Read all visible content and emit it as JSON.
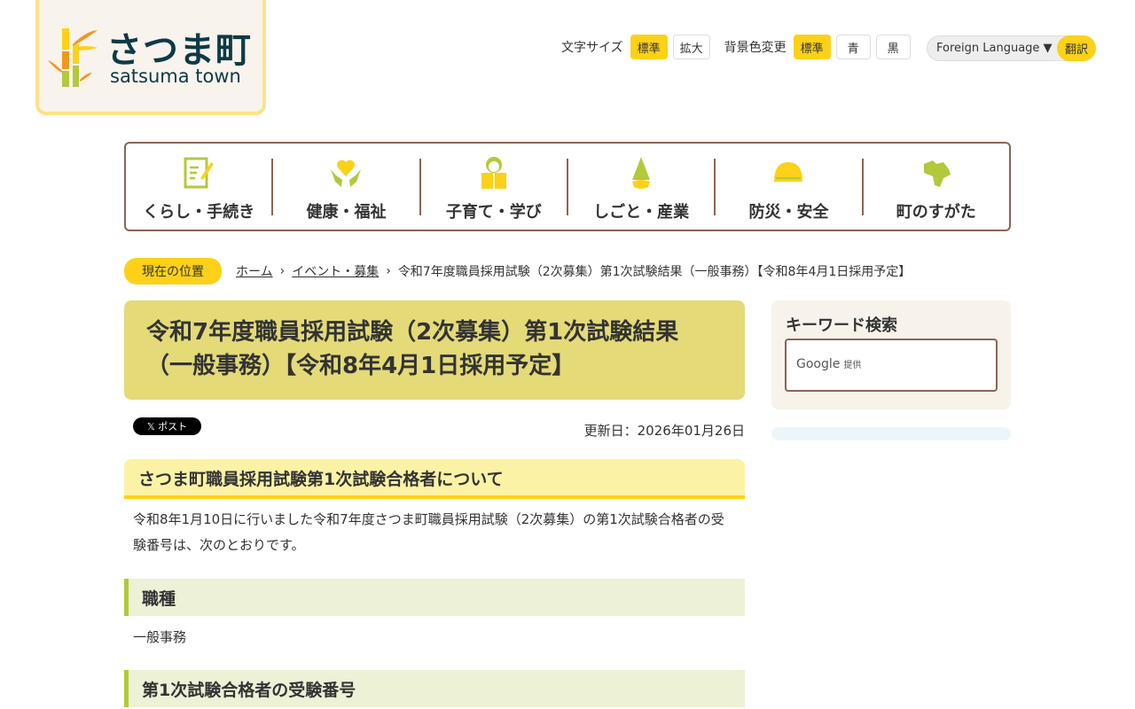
{
  "logo": {
    "jp": "さつま町",
    "en": "satsuma town"
  },
  "tools": {
    "font_size_label": "文字サイズ",
    "font_standard": "標準",
    "font_large": "拡大",
    "bg_label": "背景色変更",
    "bg_standard": "標準",
    "bg_blue": "青",
    "bg_black": "黒"
  },
  "lang": {
    "select": "Foreign Language ▼",
    "translate": "翻訳"
  },
  "nav": [
    {
      "label": "くらし・手続き",
      "icon": "document-pen-icon"
    },
    {
      "label": "健康・福祉",
      "icon": "heart-hands-icon"
    },
    {
      "label": "子育て・学び",
      "icon": "child-book-icon"
    },
    {
      "label": "しごと・産業",
      "icon": "bamboo-shoot-icon"
    },
    {
      "label": "防災・安全",
      "icon": "helmet-icon"
    },
    {
      "label": "町のすがた",
      "icon": "map-icon"
    }
  ],
  "breadcrumb": {
    "here": "現在の位置",
    "home": "ホーム",
    "events": "イベント・募集",
    "current": "令和7年度職員採用試験（2次募集）第1次試験結果（一般事務）【令和8年4月1日採用予定】"
  },
  "page": {
    "title_line1": "令和7年度職員採用試験（2次募集）第1次試験結果",
    "title_line2": "（一般事務）【令和8年4月1日採用予定】",
    "x_post": "𝕏 ポスト",
    "updated": "更新日：2026年01月26日",
    "h2": "さつま町職員採用試験第1次試験合格者について",
    "intro": "令和8年1月10日に行いました令和7年度さつま町職員採用試験（2次募集）の第1次試験合格者の受験番号は、次のとおりです。",
    "h3_job": "職種",
    "job": "一般事務",
    "h3_numbers": "第1次試験合格者の受験番号"
  },
  "sidebar": {
    "title": "キーワード検索",
    "google": "Google",
    "provided": "提供"
  }
}
